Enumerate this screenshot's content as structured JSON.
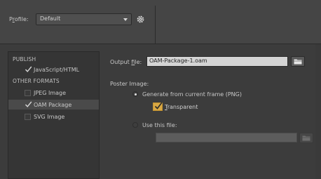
{
  "header": {
    "profile_label_prefix": "P",
    "profile_label_underlined": "r",
    "profile_label_suffix": "ofile:",
    "profile_value": "Default",
    "gear_icon": "gear-icon"
  },
  "sidebar": {
    "publish_header": "PUBLISH",
    "publish_items": [
      {
        "label": "JavaScript/HTML",
        "checked": true
      }
    ],
    "other_header": "OTHER FORMATS",
    "other_items": [
      {
        "label": "JPEG Image",
        "checked": false
      },
      {
        "label": "OAM Package",
        "checked": true,
        "selected": true
      },
      {
        "label": "SVG Image",
        "checked": false
      }
    ]
  },
  "main": {
    "output_label_prefix": "Output ",
    "output_label_underlined": "f",
    "output_label_suffix": "ile:",
    "output_value": "OAM-Package-1.oam",
    "poster_label": "Poster Image:",
    "radio_generate_label": "Generate from current frame (PNG)",
    "transparent_underlined": "T",
    "transparent_suffix": "ransparent",
    "radio_use_file_label": "Use this file:",
    "use_file_value": ""
  },
  "colors": {
    "background": "#3c3c3c",
    "checkbox_accent": "#d9a844"
  }
}
